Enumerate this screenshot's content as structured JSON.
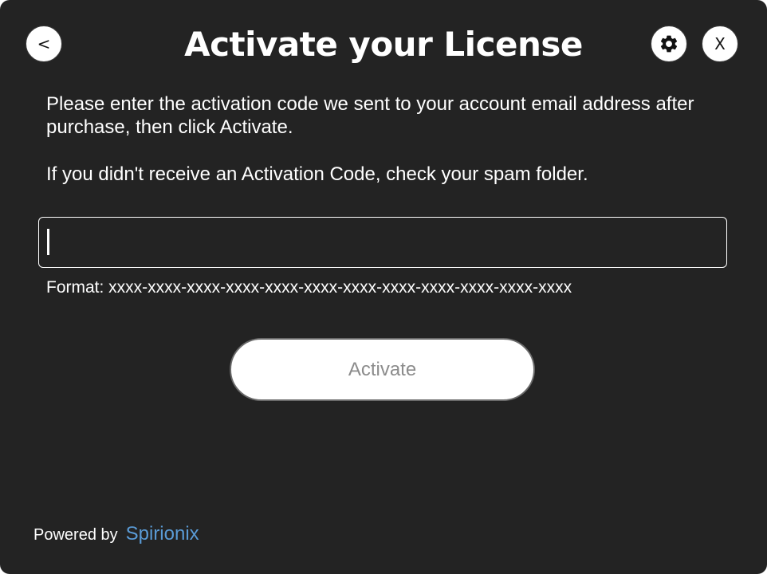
{
  "header": {
    "title": "Activate your License",
    "back_label": "<",
    "close_label": "X",
    "settings_icon": "gear-icon"
  },
  "instructions": {
    "line1": "Please enter the activation code we sent to your account email address after purchase, then click Activate.",
    "line2": "If you didn't receive an Activation Code, check your spam folder."
  },
  "code_input": {
    "value": "",
    "placeholder": ""
  },
  "format_hint": "Format: xxxx-xxxx-xxxx-xxxx-xxxx-xxxx-xxxx-xxxx-xxxx-xxxx-xxxx-xxxx",
  "activate_label": "Activate",
  "footer": {
    "powered_by": "Powered by",
    "brand": "Spirionix"
  },
  "colors": {
    "background": "#232323",
    "text": "#ffffff",
    "brand": "#5a9bd6",
    "button_disabled_text": "#8c8c8c"
  }
}
